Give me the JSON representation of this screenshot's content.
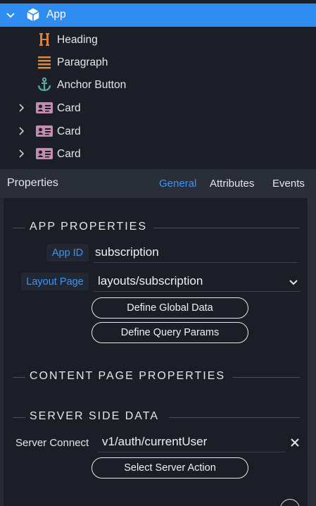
{
  "tree": {
    "root": {
      "label": "App",
      "icon": "cube-icon"
    },
    "children": [
      {
        "label": "Heading",
        "icon": "heading-icon"
      },
      {
        "label": "Paragraph",
        "icon": "paragraph-icon"
      },
      {
        "label": "Anchor Button",
        "icon": "anchor-icon"
      },
      {
        "label": "Card",
        "icon": "id-card-icon"
      },
      {
        "label": "Card",
        "icon": "id-card-icon"
      },
      {
        "label": "Card",
        "icon": "id-card-icon"
      }
    ]
  },
  "properties": {
    "title": "Properties",
    "tabs": [
      "General",
      "Attributes",
      "Events"
    ],
    "active_tab": "General"
  },
  "app_properties": {
    "section_title": "APP PROPERTIES",
    "app_id_label": "App ID",
    "app_id_value": "subscription",
    "layout_page_label": "Layout Page",
    "layout_page_value": "layouts/subscription",
    "define_global_data": "Define Global Data",
    "define_query_params": "Define Query Params"
  },
  "content_page": {
    "section_title": "CONTENT PAGE PROPERTIES"
  },
  "server_side": {
    "section_title": "SERVER SIDE DATA",
    "server_connect_label": "Server Connect",
    "server_connect_value": "v1/auth/currentUser",
    "select_action": "Select Server Action"
  },
  "colors": {
    "accent": "#2f8cf0",
    "link": "#3a95f5",
    "background": "#1b1e27",
    "heading_icon": "#e0813a",
    "paragraph_icon": "#d98a45",
    "anchor_icon": "#5aa9a0",
    "card_icon": "#c48bb0"
  }
}
